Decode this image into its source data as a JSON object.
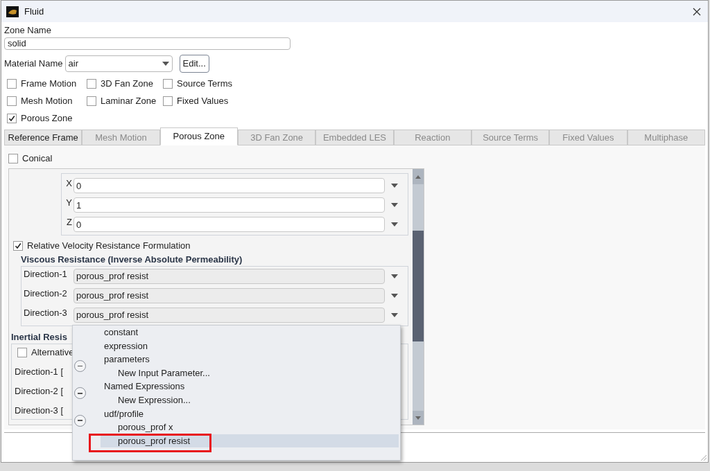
{
  "window": {
    "title": "Fluid"
  },
  "zone_name": {
    "label": "Zone Name",
    "value": "solid"
  },
  "material": {
    "label": "Material Name",
    "value": "air",
    "edit_button": "Edit..."
  },
  "options": [
    {
      "label": "Frame Motion",
      "checked": false
    },
    {
      "label": "3D Fan Zone",
      "checked": false
    },
    {
      "label": "Source Terms",
      "checked": false
    },
    {
      "label": "Mesh Motion",
      "checked": false
    },
    {
      "label": "Laminar Zone",
      "checked": false
    },
    {
      "label": "Fixed Values",
      "checked": false
    },
    {
      "label": "Porous Zone",
      "checked": true
    }
  ],
  "tabs": [
    {
      "label": "Reference Frame",
      "selected": false,
      "disabled": false
    },
    {
      "label": "Mesh Motion",
      "selected": false,
      "disabled": true
    },
    {
      "label": "Porous Zone",
      "selected": true,
      "disabled": false
    },
    {
      "label": "3D Fan Zone",
      "selected": false,
      "disabled": true
    },
    {
      "label": "Embedded LES",
      "selected": false,
      "disabled": true
    },
    {
      "label": "Reaction",
      "selected": false,
      "disabled": true
    },
    {
      "label": "Source Terms",
      "selected": false,
      "disabled": true
    },
    {
      "label": "Fixed Values",
      "selected": false,
      "disabled": true
    },
    {
      "label": "Multiphase",
      "selected": false,
      "disabled": true
    }
  ],
  "conical": {
    "label": "Conical",
    "checked": false
  },
  "direction_vector": [
    {
      "axis": "X",
      "value": "0"
    },
    {
      "axis": "Y",
      "value": "1"
    },
    {
      "axis": "Z",
      "value": "0"
    }
  ],
  "relative_velocity": {
    "label": "Relative Velocity Resistance Formulation",
    "checked": true
  },
  "viscous": {
    "title": "Viscous Resistance (Inverse Absolute Permeability)",
    "rows": [
      {
        "label": "Direction-1",
        "value": "porous_prof resist"
      },
      {
        "label": "Direction-2",
        "value": "porous_prof resist"
      },
      {
        "label": "Direction-3",
        "value": "porous_prof resist"
      }
    ]
  },
  "inertial": {
    "title": "Inertial Resis",
    "alternative": {
      "label": "Alternative",
      "checked": false
    },
    "rows": [
      "Direction-1 [",
      "Direction-2 [",
      "Direction-3 ["
    ]
  },
  "dropdown": {
    "items": [
      {
        "label": "constant",
        "selected": false
      },
      {
        "label": "expression",
        "selected": false
      },
      {
        "label": "parameters",
        "selected": false,
        "expanded": true,
        "children": [
          {
            "label": "New Input Parameter...",
            "selected": false
          }
        ]
      },
      {
        "label": "Named Expressions",
        "selected": false,
        "expanded": true,
        "children": [
          {
            "label": "New Expression...",
            "selected": false
          }
        ]
      },
      {
        "label": "udf/profile",
        "selected": false,
        "expanded": true,
        "children": [
          {
            "label": "porous_prof x",
            "selected": false
          },
          {
            "label": "porous_prof resist",
            "selected": true
          }
        ]
      }
    ]
  }
}
